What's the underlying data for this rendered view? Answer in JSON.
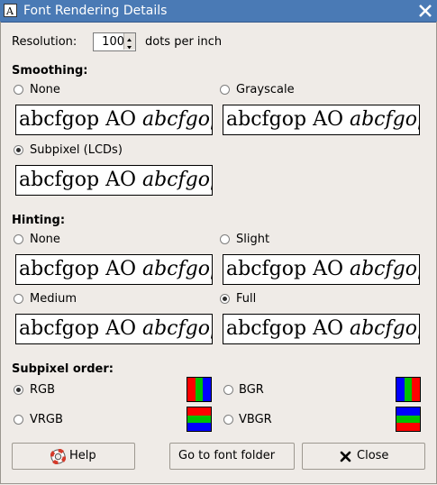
{
  "window": {
    "title": "Font Rendering Details"
  },
  "resolution": {
    "label": "Resolution:",
    "value": "100",
    "unit": "dots per inch"
  },
  "smoothing": {
    "heading": "Smoothing:",
    "none": "None",
    "grayscale": "Grayscale",
    "subpixel": "Subpixel (LCDs)",
    "selected": "Subpixel (LCDs)"
  },
  "hinting": {
    "heading": "Hinting:",
    "none": "None",
    "slight": "Slight",
    "medium": "Medium",
    "full": "Full",
    "selected": "Full"
  },
  "preview": {
    "regular": "abcfgop AO ",
    "italic": "abcfgop"
  },
  "subpixel_order": {
    "heading": "Subpixel order:",
    "rgb": "RGB",
    "bgr": "BGR",
    "vrgb": "VRGB",
    "vbgr": "VBGR",
    "selected": "RGB",
    "colors": {
      "red": "#ff0000",
      "green": "#00c000",
      "blue": "#0000ff"
    }
  },
  "buttons": {
    "help": "Help",
    "font_folder": "Go to font folder",
    "close": "Close"
  },
  "icons": {
    "help": "lifebuoy-icon",
    "close": "x-mark-icon",
    "title": "font-icon",
    "title_close": "close-icon"
  }
}
